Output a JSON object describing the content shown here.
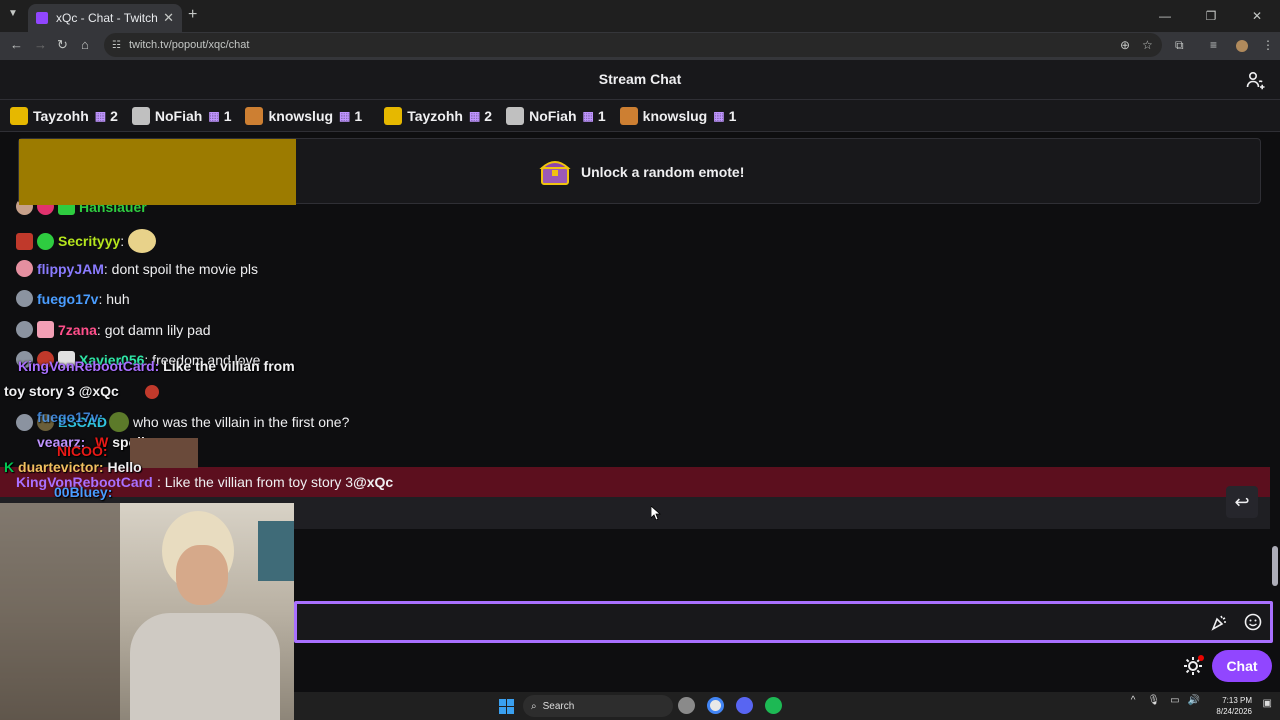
{
  "browser": {
    "tab_title": "xQc - Chat - Twitch",
    "url": "twitch.tv/popout/xqc/chat"
  },
  "header": {
    "title": "Stream Chat"
  },
  "gifters": [
    {
      "name": "Tayzohh",
      "count": "2",
      "badge_color": "#e6b800"
    },
    {
      "name": "NoFiah",
      "count": "1",
      "badge_color": "#c0c0c0"
    },
    {
      "name": "knowslug",
      "count": "1",
      "badge_color": "#cd7f32"
    },
    {
      "name": "Tayzohh",
      "count": "2",
      "badge_color": "#e6b800"
    },
    {
      "name": "NoFiah",
      "count": "1",
      "badge_color": "#c0c0c0"
    },
    {
      "name": "knowslug",
      "count": "1",
      "badge_color": "#cd7f32"
    }
  ],
  "banner": {
    "text": "Unlock a random emote!"
  },
  "messages": [
    {
      "user": "Hansiauer",
      "text": "",
      "color": "#2ecc40"
    },
    {
      "user": "Secrityyy",
      "text": "",
      "color": "#b5e61d"
    },
    {
      "user": "flippyJAM",
      "text": ": dont spoil the movie pls",
      "color": "#8a7bff"
    },
    {
      "user": "fuego17v",
      "text": ": huh",
      "color": "#4a9dff"
    },
    {
      "user": "7zana",
      "text": ": got damn lily pad",
      "color": "#ff4f8b"
    },
    {
      "user": "Xavier056",
      "text": ": freedom and love",
      "color": "#2ee6a6"
    },
    {
      "user": "ESCAD",
      "text": " who was the villain in the first one?",
      "color": "#30c5e0"
    },
    {
      "user": "KingVonRebootCard",
      "text": ": Like the villian from toy story 3 ",
      "mention": "@xQc",
      "color": "#a970ff"
    }
  ],
  "overlay": {
    "line1_user": "KingVonRebootCard:",
    "line1_text": "Like the villian from",
    "line2_text": "toy story 3 @xQc",
    "line3_user": "fuego17v:",
    "line4_user": "veaarz:",
    "line4_text": "spoils",
    "line5_user": "NICOO:",
    "line6_user": "duartevictor:",
    "line6_text": "Hello",
    "line7_user": "00Bluey:"
  },
  "input": {
    "placeholder": ""
  },
  "chat_button": "Chat",
  "taskbar": {
    "search": "Search",
    "time": "7:13 PM",
    "date": "8/24/2026"
  },
  "colors": {
    "accent": "#9146ff",
    "highlight": "#5c0f1e"
  }
}
